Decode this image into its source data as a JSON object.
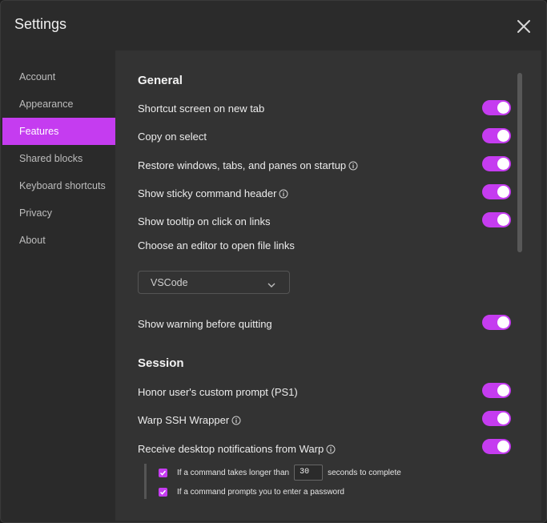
{
  "window": {
    "title": "Settings"
  },
  "sidebar": {
    "items": [
      {
        "label": "Account"
      },
      {
        "label": "Appearance"
      },
      {
        "label": "Features"
      },
      {
        "label": "Shared blocks"
      },
      {
        "label": "Keyboard shortcuts"
      },
      {
        "label": "Privacy"
      },
      {
        "label": "About"
      }
    ],
    "active": "Features"
  },
  "general": {
    "title": "General",
    "rows": [
      {
        "label": "Shortcut screen on new tab",
        "enabled": true
      },
      {
        "label": "Copy on select",
        "enabled": true
      },
      {
        "label": "Restore windows, tabs, and panes on startup",
        "enabled": true,
        "info": true
      },
      {
        "label": "Show sticky command header",
        "enabled": true,
        "info": true
      },
      {
        "label": "Show tooltip on click on links",
        "enabled": true
      }
    ],
    "editor_label": "Choose an editor to open file links",
    "editor_value": "VSCode",
    "quit_warning": {
      "label": "Show warning before quitting",
      "enabled": true
    }
  },
  "session": {
    "title": "Session",
    "rows": [
      {
        "label": "Honor user's custom prompt (PS1)",
        "enabled": true
      },
      {
        "label": "Warp SSH Wrapper",
        "enabled": true,
        "info": true
      },
      {
        "label": "Receive desktop notifications from Warp",
        "enabled": true,
        "info": true
      }
    ],
    "notify_long": {
      "prefix": "If a command takes longer than",
      "value": "30",
      "suffix": "seconds to complete",
      "checked": true
    },
    "notify_password": {
      "label": "If a command prompts you to enter a password",
      "checked": true
    }
  },
  "colors": {
    "accent": "#c53cf0",
    "background": "#333333",
    "sidebar": "#2a2a2a"
  },
  "icons": {
    "close": "close-icon",
    "info": "info-icon",
    "chevron": "chevron-down-icon",
    "check": "check-icon"
  }
}
